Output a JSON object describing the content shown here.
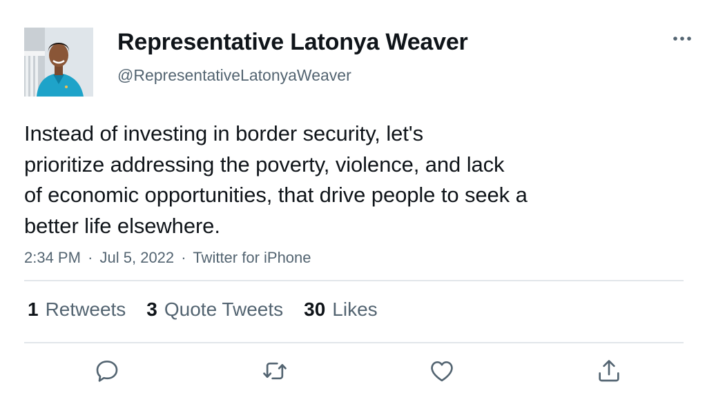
{
  "author": {
    "display_name": "Representative Latonya Weaver",
    "handle": "@RepresentativeLatonyaWeaver"
  },
  "tweet": {
    "lines": [
      "Instead of investing in border security, let's",
      "prioritize addressing the poverty, violence, and lack",
      "of economic opportunities, that drive people to seek a",
      "better life elsewhere."
    ],
    "time": "2:34 PM",
    "date": "Jul 5, 2022",
    "source": "Twitter for iPhone",
    "separator": "·"
  },
  "stats": {
    "retweets": {
      "count": "1",
      "label": "Retweets"
    },
    "quote_tweets": {
      "count": "3",
      "label": "Quote Tweets"
    },
    "likes": {
      "count": "30",
      "label": "Likes"
    }
  },
  "actions": [
    "reply-icon",
    "retweet-icon",
    "like-icon",
    "share-icon"
  ],
  "colors": {
    "text_primary": "#0f1419",
    "text_secondary": "#536471",
    "divider": "#e1e6ea",
    "icon": "#536471"
  }
}
